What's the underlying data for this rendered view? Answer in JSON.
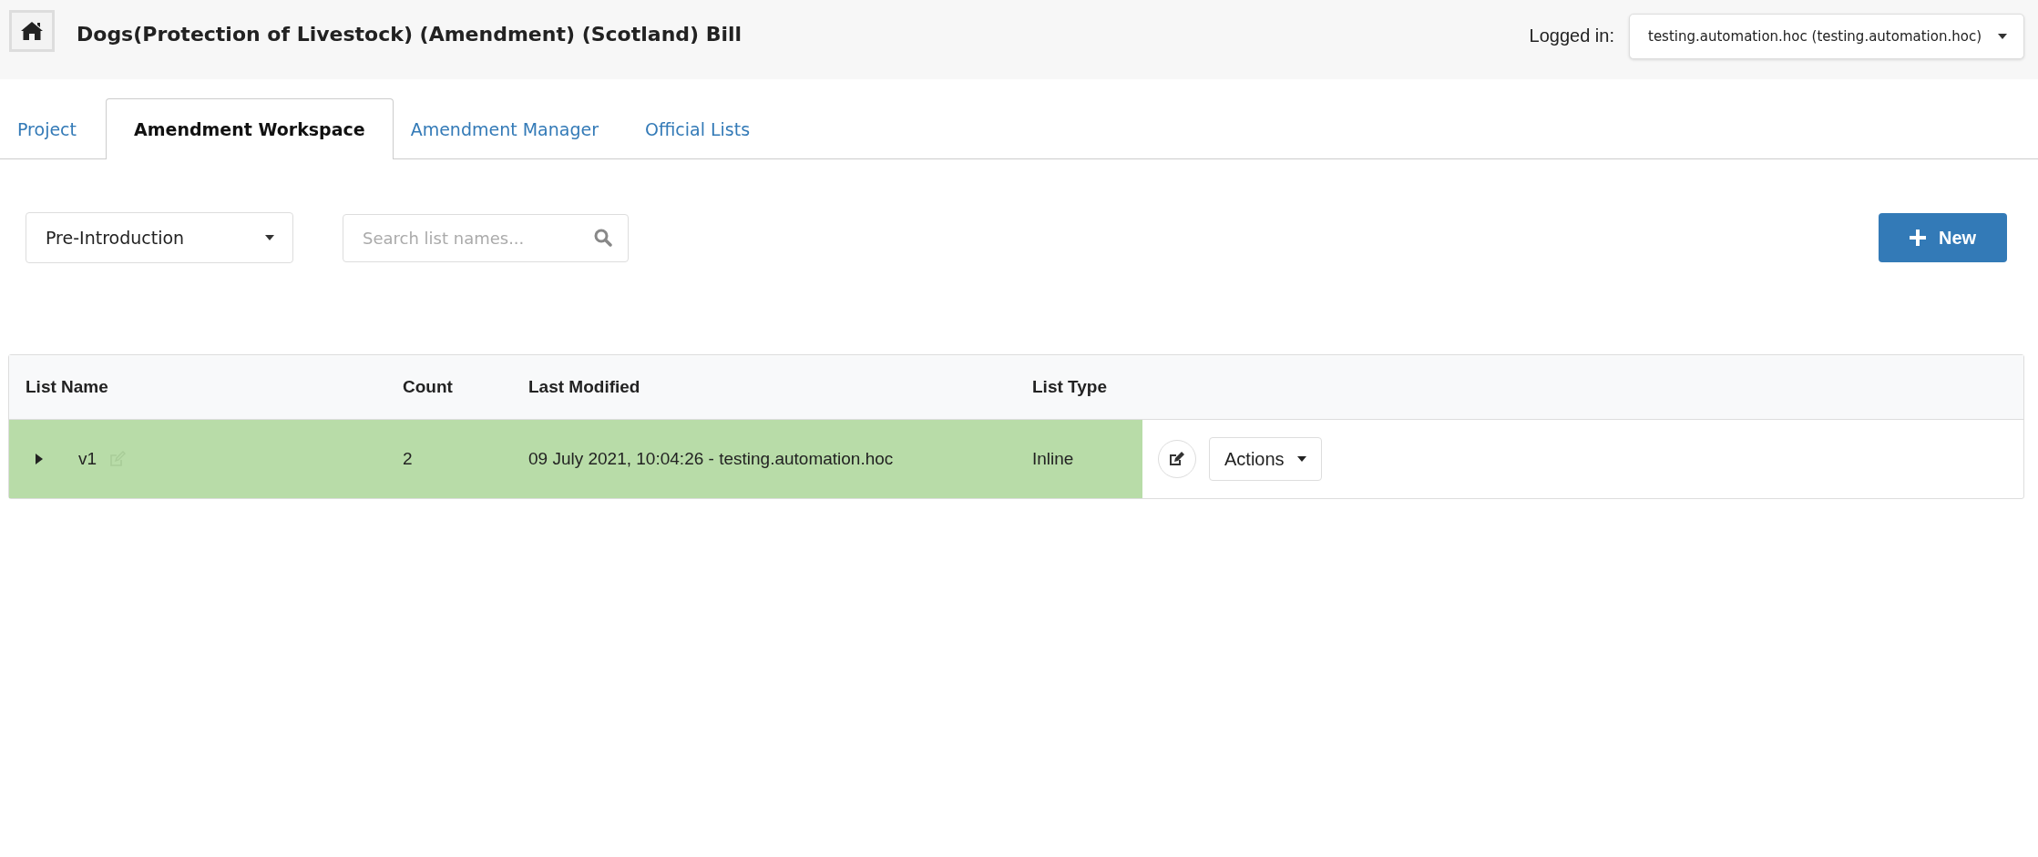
{
  "header": {
    "title": "Dogs(Protection of Livestock) (Amendment) (Scotland) Bill",
    "logged_in_label": "Logged in:",
    "user": "testing.automation.hoc (testing.automation.hoc)"
  },
  "tabs": [
    {
      "label": "Project",
      "selected": false
    },
    {
      "label": "Amendment Workspace",
      "selected": true
    },
    {
      "label": "Amendment Manager",
      "selected": false
    },
    {
      "label": "Official Lists",
      "selected": false
    }
  ],
  "toolbar": {
    "stage": "Pre-Introduction",
    "search": {
      "placeholder": "Search list names..."
    },
    "new_button": "New"
  },
  "table": {
    "columns": [
      "List Name",
      "Count",
      "Last Modified",
      "List Type"
    ],
    "rows": [
      {
        "selected": true,
        "expanded": false,
        "name": "v1",
        "count": "2",
        "last_modified": "09 July 2021, 10:04:26 - testing.automation.hoc",
        "list_type": "Inline",
        "actions": "Actions"
      }
    ]
  }
}
